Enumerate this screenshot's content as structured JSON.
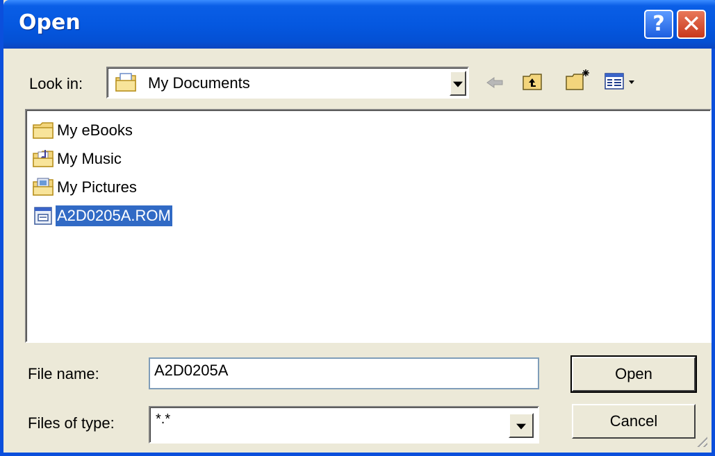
{
  "window": {
    "title": "Open",
    "help_label": "?",
    "close_label": "✕"
  },
  "lookin": {
    "label": "Look in:",
    "value": "My Documents"
  },
  "files": [
    {
      "name": "My eBooks",
      "icon": "folder-icon"
    },
    {
      "name": "My Music",
      "icon": "music-folder-icon"
    },
    {
      "name": "My Pictures",
      "icon": "pictures-folder-icon"
    },
    {
      "name": "A2D0205A.ROM",
      "icon": "rom-file-icon",
      "selected": true
    }
  ],
  "filename": {
    "label": "File name:",
    "value": "A2D0205A"
  },
  "filetype": {
    "label": "Files of type:",
    "value": "*.*"
  },
  "buttons": {
    "open": "Open",
    "cancel": "Cancel"
  },
  "colors": {
    "titlebar": "#0558e0",
    "selection": "#316ac5",
    "face": "#ece9d8"
  }
}
